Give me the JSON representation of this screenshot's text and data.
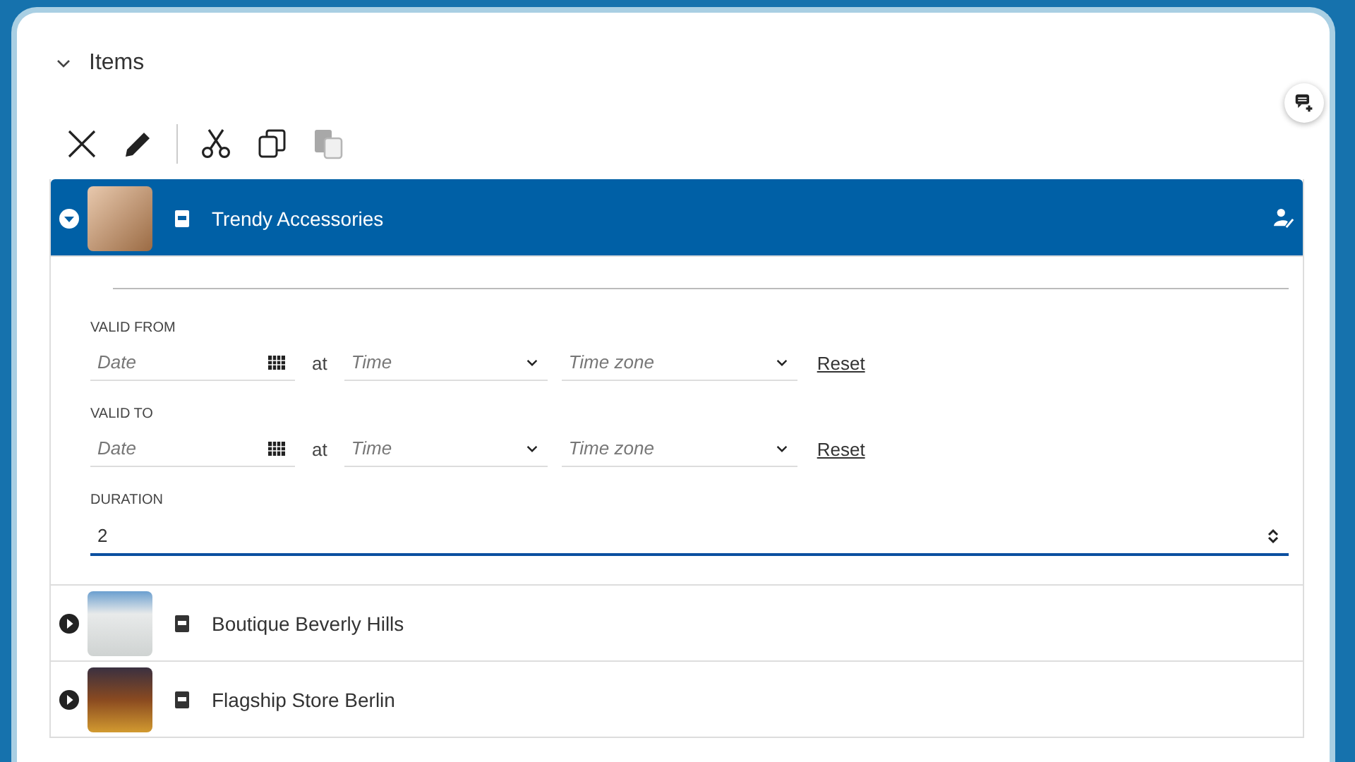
{
  "section": {
    "title": "Items",
    "expanded": true
  },
  "toolbar": [
    {
      "kind": "delete",
      "disabled": false
    },
    {
      "kind": "edit",
      "disabled": false
    },
    {
      "kind": "cut",
      "disabled": false
    },
    {
      "kind": "copy",
      "disabled": false
    },
    {
      "kind": "paste",
      "disabled": true
    }
  ],
  "items": [
    {
      "name": "Trendy Accessories",
      "expanded": true,
      "selected": true,
      "details": {
        "ranges": [
          {
            "label": "VALID FROM",
            "date_placeholder": "Date",
            "at": "at",
            "time_placeholder": "Time",
            "zone_placeholder": "Time zone",
            "reset": "Reset"
          },
          {
            "label": "VALID TO",
            "date_placeholder": "Date",
            "at": "at",
            "time_placeholder": "Time",
            "zone_placeholder": "Time zone",
            "reset": "Reset"
          }
        ],
        "duration": {
          "label": "DURATION",
          "value": "2"
        }
      }
    },
    {
      "name": "Boutique Beverly Hills",
      "expanded": false,
      "selected": false
    },
    {
      "name": "Flagship Store Berlin",
      "expanded": false,
      "selected": false
    }
  ]
}
